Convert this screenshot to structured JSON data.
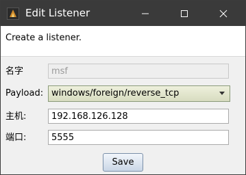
{
  "window": {
    "title": "Edit Listener",
    "icon": "app-icon",
    "controls": [
      "minimize-icon",
      "maximize-icon",
      "close-icon"
    ]
  },
  "banner": {
    "text": "Create a listener."
  },
  "form": {
    "name": {
      "label": "名字",
      "value": "msf"
    },
    "payload": {
      "label": "Payload:",
      "value": "windows/foreign/reverse_tcp"
    },
    "host": {
      "label": "主机:",
      "value": "192.168.126.128"
    },
    "port": {
      "label": "端口:",
      "value": "5555"
    }
  },
  "actions": {
    "save_label": "Save"
  },
  "colors": {
    "titlebar": "#3a3a3a",
    "banner": "#ffffff",
    "body": "#f0f0f0",
    "select": "#dfe3c8"
  }
}
